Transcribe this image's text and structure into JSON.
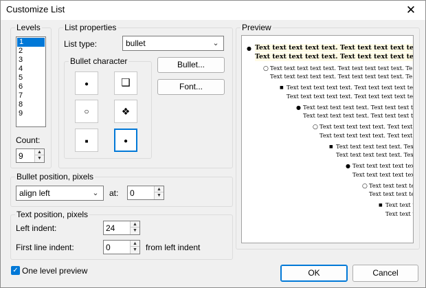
{
  "window": {
    "title": "Customize List",
    "close_glyph": "✕"
  },
  "levels": {
    "group_label": "Levels",
    "items": [
      "1",
      "2",
      "3",
      "4",
      "5",
      "6",
      "7",
      "8",
      "9"
    ],
    "selected": "1",
    "count_label": "Count:",
    "count_value": "9"
  },
  "list_properties": {
    "group_label": "List properties",
    "list_type_label": "List type:",
    "list_type_value": "bullet",
    "bullet_character_label": "Bullet character",
    "bullet_chars": [
      {
        "icon": "filled-dot-icon",
        "glyph": "●"
      },
      {
        "icon": "shadow-square-icon",
        "glyph": "❑"
      },
      {
        "icon": "hollow-circle-icon",
        "glyph": "○"
      },
      {
        "icon": "four-diamond-icon",
        "glyph": "❖"
      },
      {
        "icon": "small-square-icon",
        "glyph": "■"
      },
      {
        "icon": "filled-dot-icon",
        "glyph": "●"
      }
    ],
    "bullet_button": "Bullet...",
    "font_button": "Font..."
  },
  "bullet_position": {
    "group_label": "Bullet position, pixels",
    "align_value": "align left",
    "at_label": "at:",
    "at_value": "0"
  },
  "text_position": {
    "group_label": "Text position, pixels",
    "left_indent_label": "Left indent:",
    "left_indent_value": "24",
    "first_line_label": "First line indent:",
    "first_line_value": "0",
    "from_left_label": "from left indent"
  },
  "preview": {
    "group_label": "Preview",
    "levels": [
      {
        "glyph": "●",
        "lines": [
          "Text text text text text. Text text text text text. Te",
          "Text text text text text. Text text text text text. Te"
        ]
      },
      {
        "glyph": "○",
        "lines": [
          "Text text text text text. Text text text text text. Te",
          "Text text text text text. Text text text text text. Te"
        ]
      },
      {
        "glyph": "■",
        "lines": [
          "Text text text text text. Text text text text text. Te",
          "Text text text text text. Text text text text text. Te"
        ]
      },
      {
        "glyph": "●",
        "lines": [
          "Text text text text text. Text text text text text. Te",
          "Text text text text text. Text text text text text. Te"
        ]
      },
      {
        "glyph": "○",
        "lines": [
          "Text text text text text. Text text text text text. Te",
          "Text text text text text. Text text text text text. Te"
        ]
      },
      {
        "glyph": "■",
        "lines": [
          "Text text text text text. Text text text text text. Te",
          "Text text text text text. Text text text text text. Te"
        ]
      },
      {
        "glyph": "●",
        "lines": [
          "Text text text text text. Text text text text text. Te",
          "Text text text text text. Text text text text text. Te"
        ]
      },
      {
        "glyph": "○",
        "lines": [
          "Text text text text text. Text text text text text. Te",
          "Text text text text text. Text text text text text. Te"
        ]
      },
      {
        "glyph": "■",
        "lines": [
          "Text text text text text. Text text text text text. Te",
          "Text text text text text. Text text text text text. Te"
        ]
      }
    ]
  },
  "one_level_preview": {
    "label": "One level preview",
    "checked": true
  },
  "buttons": {
    "ok": "OK",
    "cancel": "Cancel"
  },
  "colors": {
    "accent": "#0078d7",
    "dialog_bg": "#f0f0f0"
  }
}
